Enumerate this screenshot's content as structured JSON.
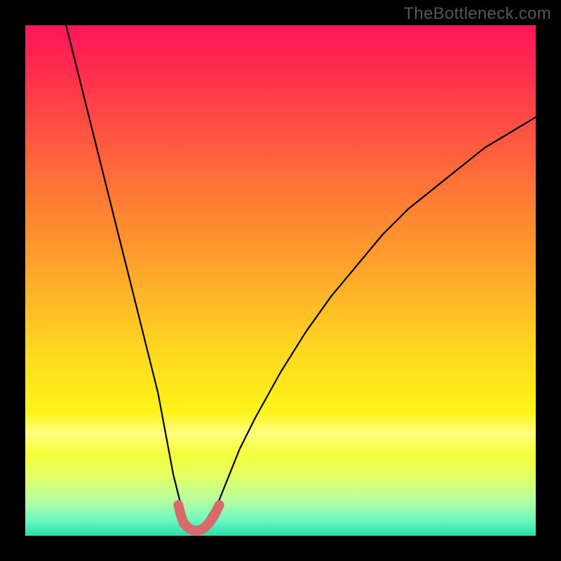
{
  "watermark": "TheBottleneck.com",
  "chart_data": {
    "type": "line",
    "title": "",
    "xlabel": "",
    "ylabel": "",
    "xlim": [
      0,
      100
    ],
    "ylim": [
      0,
      100
    ],
    "series": [
      {
        "name": "curve",
        "x": [
          8,
          10,
          12,
          14,
          16,
          18,
          20,
          22,
          24,
          26,
          27.5,
          29,
          30,
          31,
          32,
          33,
          34,
          35,
          36,
          38,
          40,
          42,
          45,
          50,
          55,
          60,
          65,
          70,
          75,
          80,
          85,
          90,
          95,
          100
        ],
        "values": [
          100,
          92,
          84,
          76,
          68,
          60,
          52,
          44,
          36,
          28,
          20,
          12,
          8,
          4,
          2,
          1,
          1,
          2,
          4,
          7,
          12,
          17,
          23,
          32,
          40,
          47,
          53,
          59,
          64,
          68,
          72,
          76,
          79,
          82
        ]
      },
      {
        "name": "bottom-highlight",
        "x": [
          30,
          30.5,
          31,
          32,
          33,
          34,
          35,
          36,
          37,
          38
        ],
        "values": [
          6,
          4,
          2.5,
          1.5,
          1,
          1,
          1.5,
          2.5,
          4,
          6
        ]
      }
    ],
    "gradient_stops": [
      {
        "pos": 0,
        "color": "#ff1458"
      },
      {
        "pos": 22,
        "color": "#ff5640"
      },
      {
        "pos": 52,
        "color": "#ffb228"
      },
      {
        "pos": 74,
        "color": "#fff018"
      },
      {
        "pos": 93,
        "color": "#b8ffa0"
      },
      {
        "pos": 100,
        "color": "#26e0a8"
      }
    ]
  }
}
